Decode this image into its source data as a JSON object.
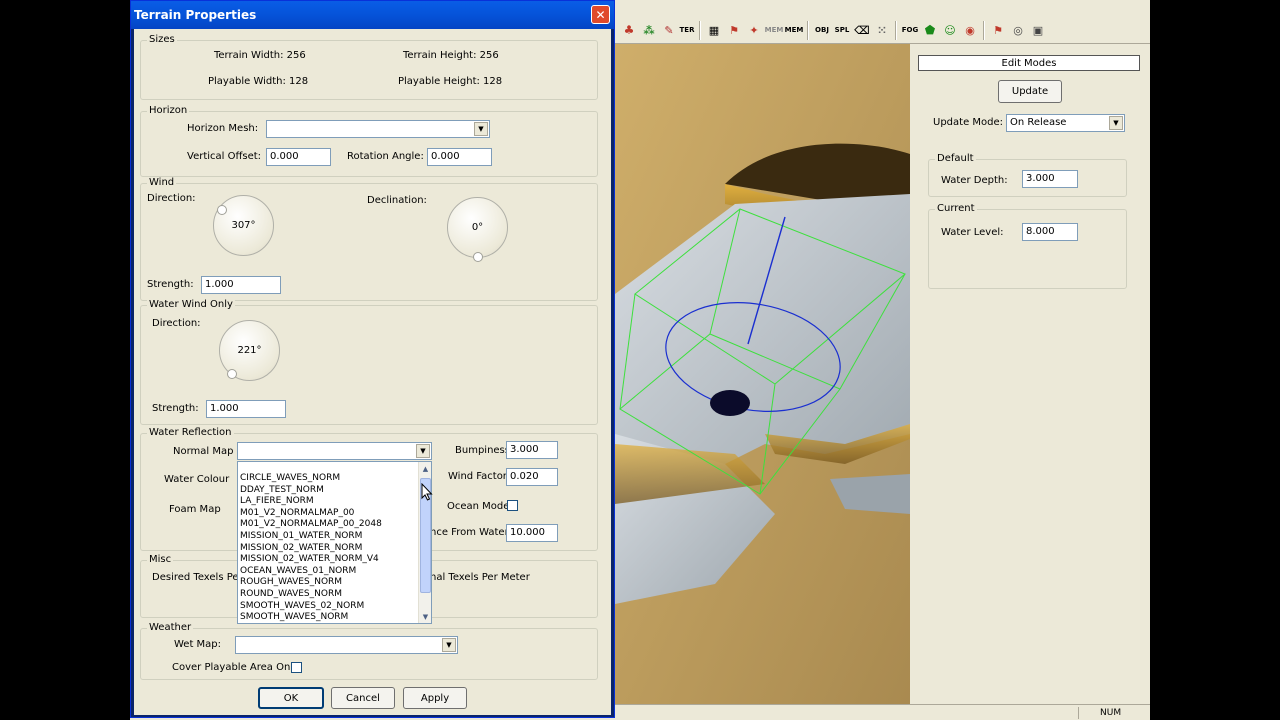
{
  "dialog": {
    "title": "Terrain Properties",
    "close_glyph": "✕",
    "sizes": {
      "title": "Sizes",
      "terrain_width": "Terrain Width: 256",
      "terrain_height": "Terrain Height: 256",
      "playable_width": "Playable Width: 128",
      "playable_height": "Playable Height: 128"
    },
    "horizon": {
      "title": "Horizon",
      "mesh_label": "Horizon Mesh:",
      "mesh_value": "",
      "vertical_offset_label": "Vertical Offset:",
      "vertical_offset_value": "0.000",
      "rotation_angle_label": "Rotation Angle:",
      "rotation_angle_value": "0.000"
    },
    "wind": {
      "title": "Wind",
      "direction_label": "Direction:",
      "direction_value": "307°",
      "declination_label": "Declination:",
      "declination_value": "0°",
      "strength_label": "Strength:",
      "strength_value": "1.000"
    },
    "water_wind": {
      "title": "Water Wind Only",
      "direction_label": "Direction:",
      "direction_value": "221°",
      "strength_label": "Strength:",
      "strength_value": "1.000"
    },
    "water_reflection": {
      "title": "Water Reflection",
      "normal_map_label": "Normal Map",
      "normal_map_value": "",
      "water_colour_label": "Water Colour",
      "foam_map_label": "Foam Map",
      "bumpiness_label": "Bumpiness",
      "bumpiness_value": "3.000",
      "wind_factor_label": "Wind Factor",
      "wind_factor_value": "0.020",
      "ocean_mode_label": "Ocean Mode",
      "distance_label": "nce From Water",
      "distance_value": "10.000",
      "normal_map_options": [
        "CIRCLE_WAVES_NORM",
        "DDAY_TEST_NORM",
        "LA_FIERE_NORM",
        "M01_V2_NORMALMAP_00",
        "M01_V2_NORMALMAP_00_2048",
        "MISSION_01_WATER_NORM",
        "MISSION_02_WATER_NORM",
        "MISSION_02_WATER_NORM_V4",
        "OCEAN_WAVES_01_NORM",
        "ROUGH_WAVES_NORM",
        "ROUND_WAVES_NORM",
        "SMOOTH_WAVES_02_NORM",
        "SMOOTH_WAVES_NORM"
      ]
    },
    "misc": {
      "title": "Misc",
      "desired_texels_label": "Desired Texels Per",
      "normal_texels_label": "nal Texels Per Meter"
    },
    "weather": {
      "title": "Weather",
      "wet_map_label": "Wet Map:",
      "wet_map_value": "",
      "cover_playable_label": "Cover Playable Area Only:"
    },
    "buttons": {
      "ok": "OK",
      "cancel": "Cancel",
      "apply": "Apply"
    }
  },
  "toolbar": {
    "terrain_label": "TER",
    "mem_label": "MEM",
    "obj_label": "OBJ",
    "spl_label": "SPL",
    "fog_label": "FOG"
  },
  "right_panel": {
    "edit_modes_label": "Edit Modes",
    "update_button": "Update",
    "update_mode_label": "Update Mode:",
    "update_mode_value": "On Release",
    "default_group": "Default",
    "water_depth_label": "Water Depth:",
    "water_depth_value": "3.000",
    "current_group": "Current",
    "water_level_label": "Water Level:",
    "water_level_value": "8.000"
  },
  "statusbar": {
    "num_indicator": "NUM"
  },
  "colors": {
    "titlebar": "#0553d9",
    "dialog_bg": "#ece9d8",
    "gizmo_green": "#3ee03e",
    "gizmo_blue": "#1a2fd0",
    "water": "#b4bcc4",
    "sand": "#c6a560"
  }
}
